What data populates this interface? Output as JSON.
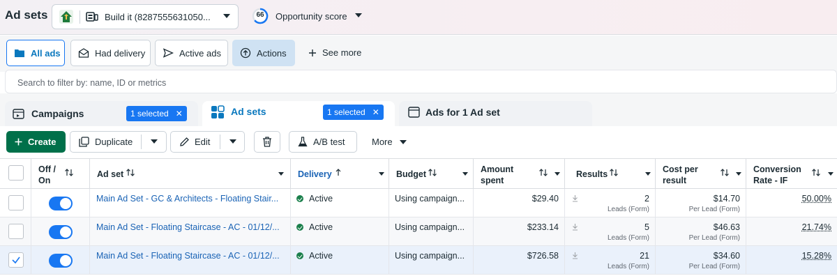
{
  "header": {
    "title": "Ad sets",
    "account_name": "Build it (8287555631050...",
    "opportunity_score": "66",
    "opportunity_label": "Opportunity score"
  },
  "filters": {
    "all_ads": "All ads",
    "had_delivery": "Had delivery",
    "active_ads": "Active ads",
    "actions": "Actions",
    "see_more": "See more"
  },
  "search": {
    "placeholder": "Search to filter by: name, ID or metrics"
  },
  "level_tabs": {
    "campaigns": "Campaigns",
    "campaigns_selected": "1 selected",
    "adsets": "Ad sets",
    "adsets_selected": "1 selected",
    "ads": "Ads for 1 Ad set"
  },
  "toolbar": {
    "create": "Create",
    "duplicate": "Duplicate",
    "edit": "Edit",
    "ab_test": "A/B test",
    "more": "More"
  },
  "columns": {
    "off_on": "Off /",
    "off_on2": "On",
    "ad_set": "Ad set",
    "delivery": "Delivery",
    "budget": "Budget",
    "amount": "Amount",
    "amount2": "spent",
    "results": "Results",
    "cost": "Cost per",
    "cost2": "result",
    "conv": "Conversion",
    "conv2": "Rate - IF"
  },
  "rows": [
    {
      "name": "Main Ad Set - GC & Architects - Floating Stair...",
      "delivery": "Active",
      "budget": "Using campaign...",
      "spent": "$29.40",
      "results": "2",
      "results_sub": "Leads (Form)",
      "cost": "$14.70",
      "cost_sub": "Per Lead (Form)",
      "conv": "50.00%",
      "checked": false
    },
    {
      "name": "Main Ad Set - Floating Staircase - AC - 01/12/...",
      "delivery": "Active",
      "budget": "Using campaign...",
      "spent": "$233.14",
      "results": "5",
      "results_sub": "Leads (Form)",
      "cost": "$46.63",
      "cost_sub": "Per Lead (Form)",
      "conv": "21.74%",
      "checked": false
    },
    {
      "name": "Main Ad Set - Floating Staircase - AC - 01/12/...",
      "delivery": "Active",
      "budget": "Using campaign...",
      "spent": "$726.58",
      "results": "21",
      "results_sub": "Leads (Form)",
      "cost": "$34.60",
      "cost_sub": "Per Lead (Form)",
      "conv": "15.28%",
      "checked": true
    }
  ],
  "colors": {
    "accent": "#1877f2",
    "create_green": "#00704a",
    "link": "#1a63b5",
    "active_green": "#1a7f4b"
  }
}
